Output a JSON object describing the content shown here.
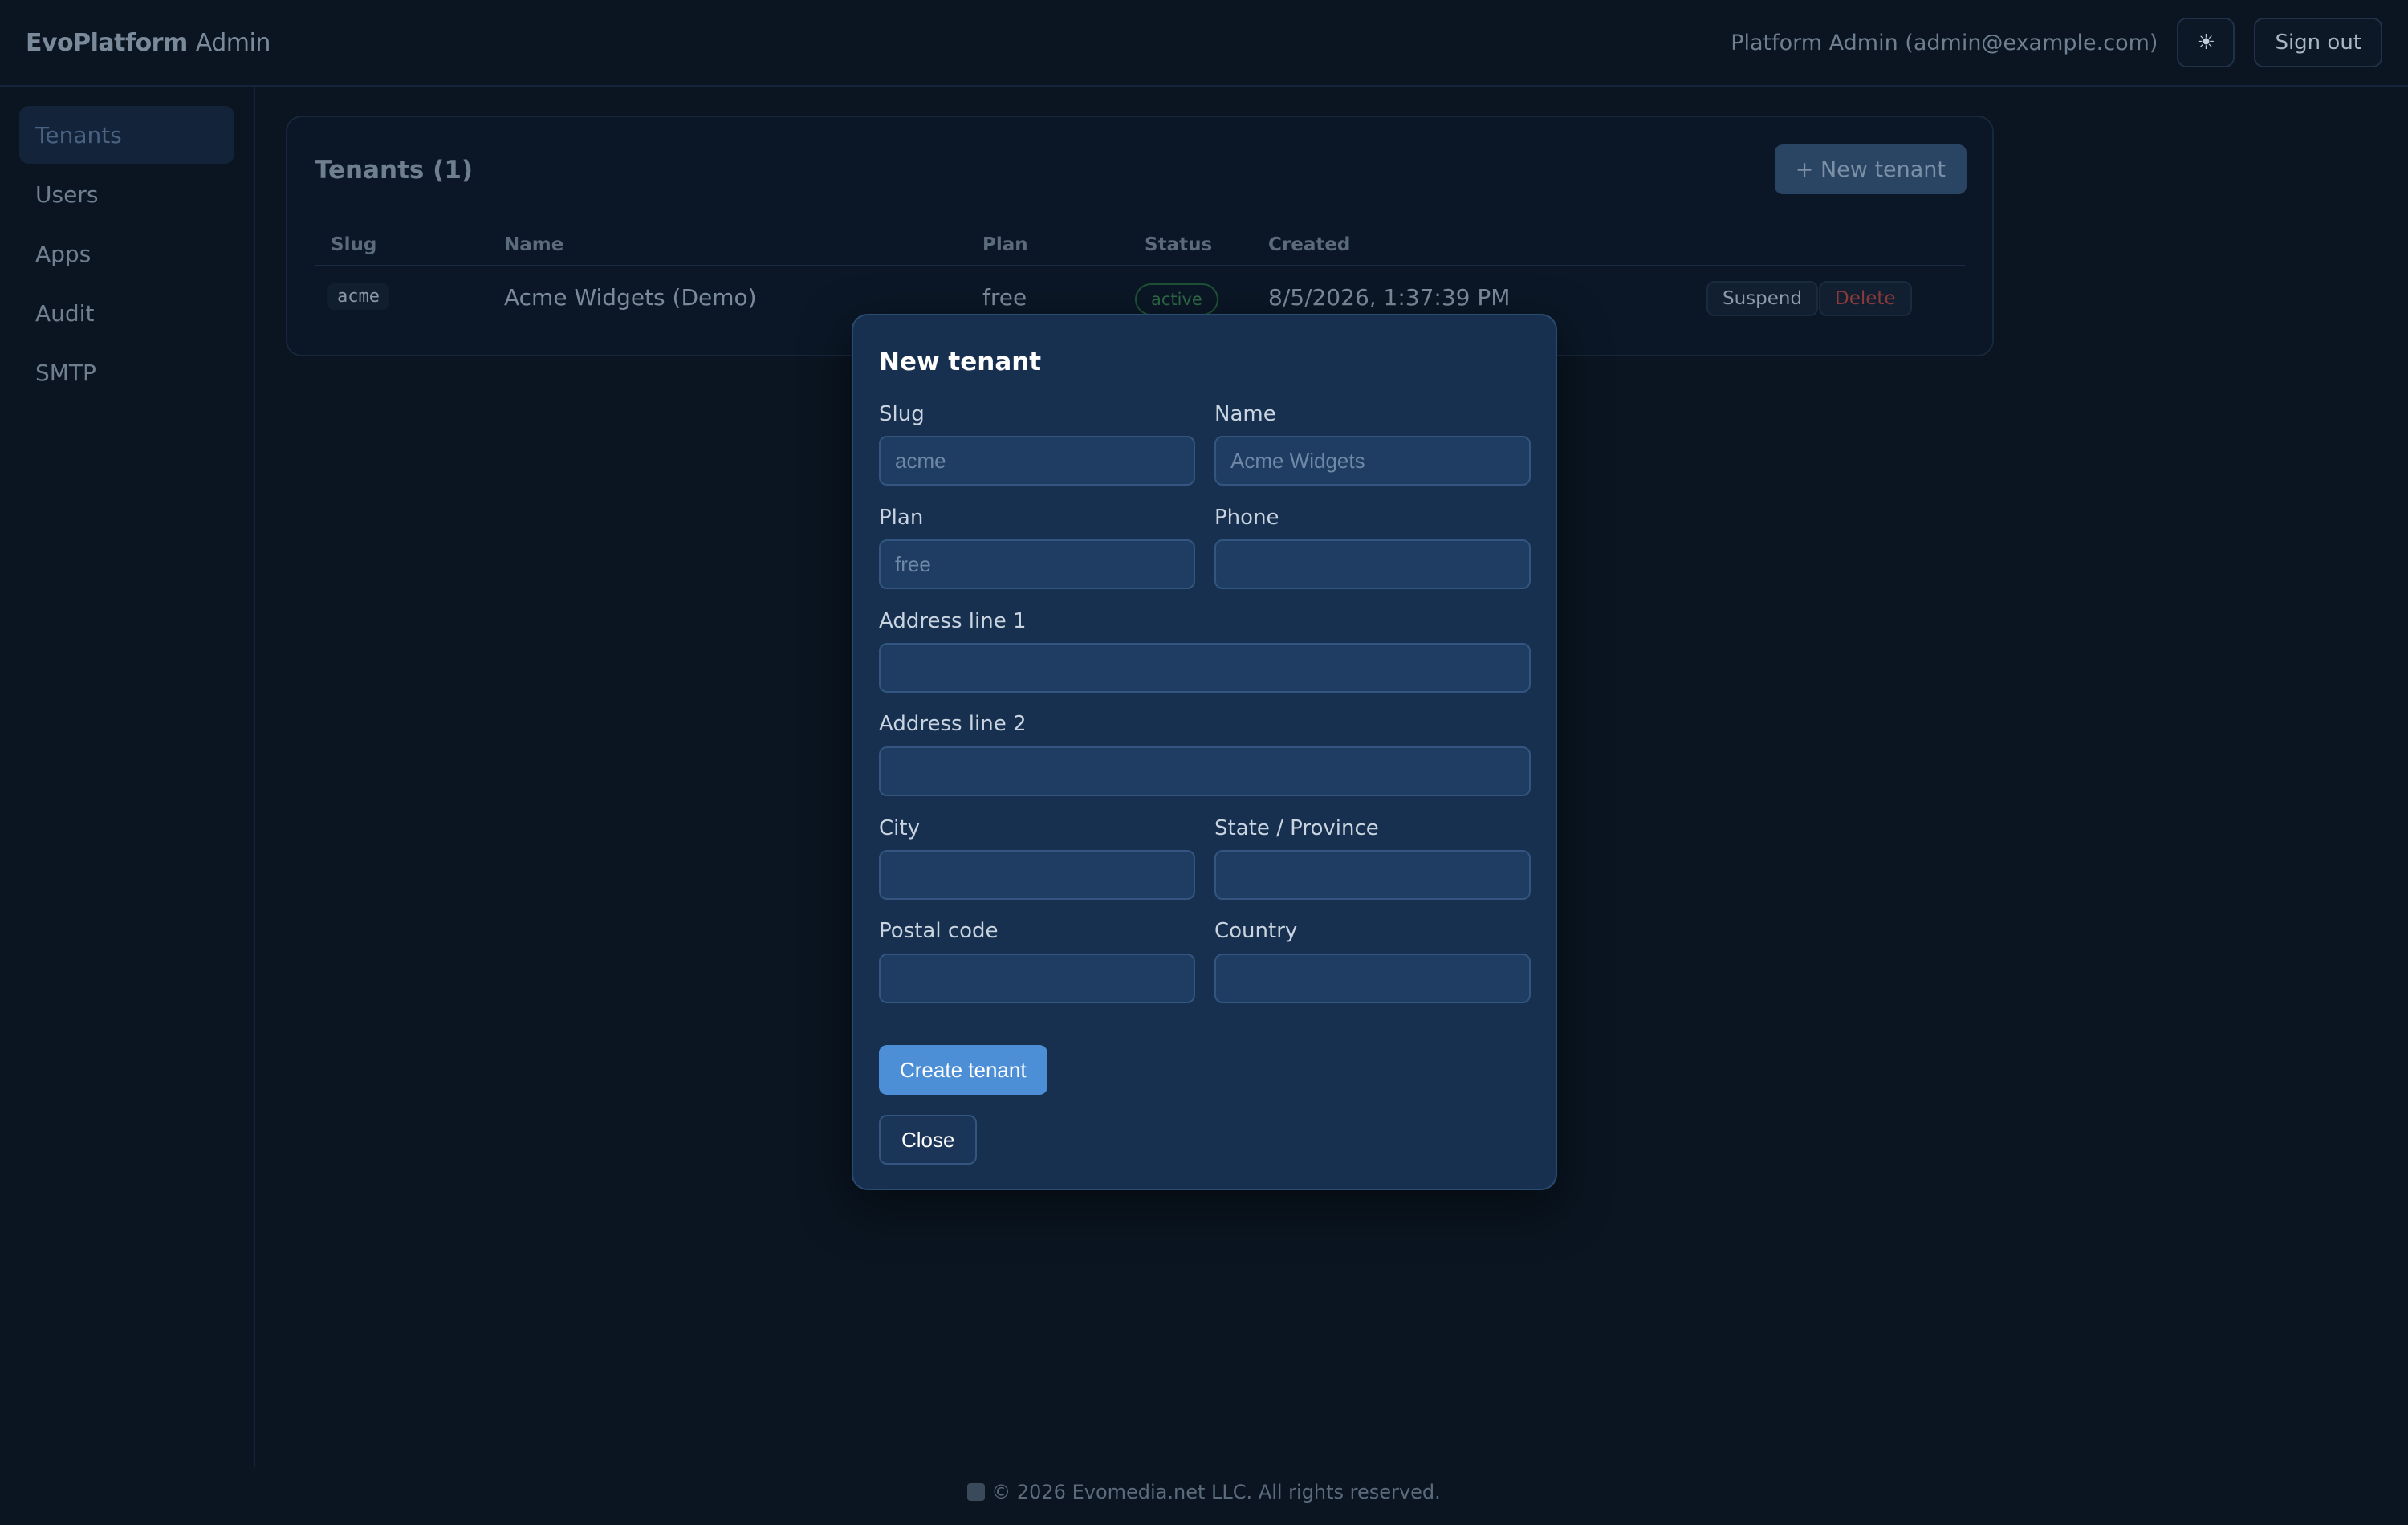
{
  "header": {
    "brand": "EvoPlatform",
    "brand_sub": "Admin",
    "user": "Platform Admin (admin@example.com)",
    "theme_icon": "sun-icon",
    "theme_glyph": "☀",
    "sign_out": "Sign out"
  },
  "sidebar": {
    "items": [
      {
        "label": "Tenants"
      },
      {
        "label": "Users"
      },
      {
        "label": "Apps"
      },
      {
        "label": "Audit"
      },
      {
        "label": "SMTP"
      }
    ]
  },
  "main": {
    "title": "Tenants (1)",
    "new_button": "+ New tenant",
    "columns": [
      "Slug",
      "Name",
      "Plan",
      "Status",
      "Created"
    ],
    "rows": [
      {
        "slug": "acme",
        "name": "Acme Widgets (Demo)",
        "plan": "free",
        "status": "active",
        "created": "8/5/2026, 1:37:39 PM",
        "suspend": "Suspend",
        "delete": "Delete"
      }
    ]
  },
  "modal": {
    "title": "New tenant",
    "slug_label": "Slug",
    "slug_placeholder": "acme",
    "name_label": "Name",
    "name_placeholder": "Acme Widgets",
    "plan_label": "Plan",
    "plan_placeholder": "free",
    "phone_label": "Phone",
    "address1_label": "Address line 1",
    "address2_label": "Address line 2",
    "city_label": "City",
    "state_label": "State / Province",
    "postal_label": "Postal code",
    "country_label": "Country",
    "create_button": "Create tenant",
    "close_button": "Close"
  },
  "footer": {
    "text": "© 2026 Evomedia.net LLC. All rights reserved."
  },
  "colors": {
    "background": "#0a1521",
    "modal": "#17304f",
    "accent": "#4d8fd6",
    "status_active": "#2e6a45",
    "danger": "#8a3a3a"
  }
}
